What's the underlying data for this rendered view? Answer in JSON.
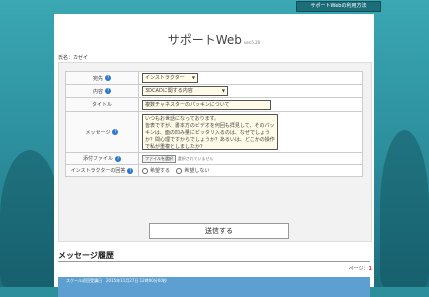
{
  "topbar": {
    "usage_button": "サポートWebの利用方法"
  },
  "header": {
    "title": "サポートWeb",
    "version": "ver.5.20"
  },
  "user": {
    "name_label": "氏名：カゼイ"
  },
  "form": {
    "rows": [
      {
        "label": "宛先",
        "value": "インストラクター"
      },
      {
        "label": "内容",
        "value": "3DCADに関する内容"
      },
      {
        "label": "タイトル",
        "value": "複数チャネスターのパッキンについて"
      },
      {
        "label": "メッセージ",
        "value": "いつもお世話になっております。\n皆表ですが、書本方のビデオを何回も拝見して、そのパッキンは、面の凹み量にピッタリ入るのは、なぜでしょうか？間心理ですからでしょうか？あるいは、どこかの操作で私が重複としましたか？"
      },
      {
        "label": "添付ファイル",
        "file_button": "ファイルを選択",
        "file_status": "選択されていません"
      },
      {
        "label": "インストラクターの回答",
        "options": [
          "希望する",
          "希望しない"
        ]
      }
    ],
    "send_button": "送信する"
  },
  "history": {
    "heading": "メッセージ履歴",
    "page_label": "ページ：",
    "page_number": "1",
    "item_text": "スクール初回受講日　2015年11月27日 12時00分00秒"
  },
  "colors": {
    "accent": "#2a76c9",
    "bg": "#2d8e9c",
    "topbar": "#1c6d77"
  }
}
